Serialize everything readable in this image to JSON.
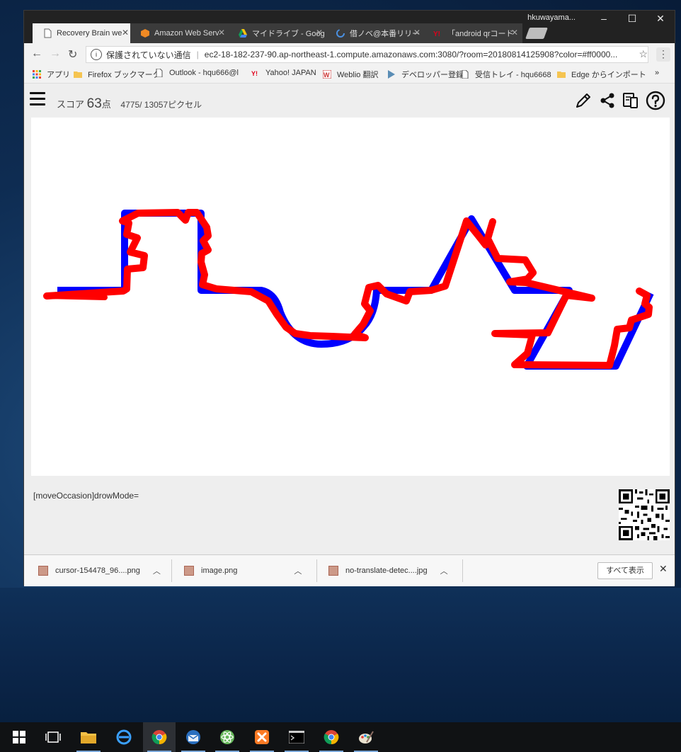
{
  "window": {
    "user_name": "hkuwayama...",
    "tabs": [
      {
        "label": "Recovery Brain we",
        "active": true,
        "favicon": "page-icon"
      },
      {
        "label": "Amazon Web Serv",
        "active": false,
        "favicon": "aws-icon"
      },
      {
        "label": "マイドライブ - Goog",
        "active": false,
        "favicon": "google-drive-icon"
      },
      {
        "label": "借ノベ@本番リリー",
        "active": false,
        "favicon": "loading-icon"
      },
      {
        "label": "「android qrコード",
        "active": false,
        "favicon": "yahoo-icon"
      }
    ],
    "controls": {
      "minimize": "–",
      "maximize": "☐",
      "close": "✕"
    }
  },
  "toolbar": {
    "security_label": "保護されていない通信",
    "url": "ec2-18-182-237-90.ap-northeast-1.compute.amazonaws.com:3080/?room=20180814125908?color=#ff0000..."
  },
  "bookmarks": [
    {
      "label": "アプリ",
      "icon": "apps-grid-icon"
    },
    {
      "label": "Firefox ブックマーク",
      "icon": "folder-icon"
    },
    {
      "label": "Outlook - hqu666@l",
      "icon": "page-icon"
    },
    {
      "label": "Yahoo! JAPAN",
      "icon": "yahoo-icon"
    },
    {
      "label": "Weblio 翻訳",
      "icon": "weblio-icon"
    },
    {
      "label": "デベロッパー登録",
      "icon": "play-icon"
    },
    {
      "label": "受信トレイ - hqu6668",
      "icon": "page-icon"
    },
    {
      "label": "Edge からインポート",
      "icon": "folder-icon"
    }
  ],
  "bookmarks_more": "»",
  "app": {
    "score_prefix": "スコア",
    "score_value": "63",
    "score_unit": "点",
    "pixel_text": "4775/ 13057ピクセル",
    "status_text": "[moveOccasion]drowMode=",
    "colors": {
      "target_line": "#0000ff",
      "drawn_line": "#ff0000"
    }
  },
  "downloads": [
    {
      "name": "cursor-154478_96....png"
    },
    {
      "name": "image.png"
    },
    {
      "name": "no-translate-detec....jpg"
    }
  ],
  "downloads_show_all": "すべて表示",
  "taskbar": [
    {
      "name": "windows-start-icon"
    },
    {
      "name": "task-view-icon"
    },
    {
      "name": "file-explorer-icon"
    },
    {
      "name": "edge-icon"
    },
    {
      "name": "chrome-icon"
    },
    {
      "name": "thunderbird-icon"
    },
    {
      "name": "atom-icon"
    },
    {
      "name": "xampp-icon"
    },
    {
      "name": "terminal-icon"
    },
    {
      "name": "chrome-icon"
    },
    {
      "name": "paint-icon"
    }
  ]
}
